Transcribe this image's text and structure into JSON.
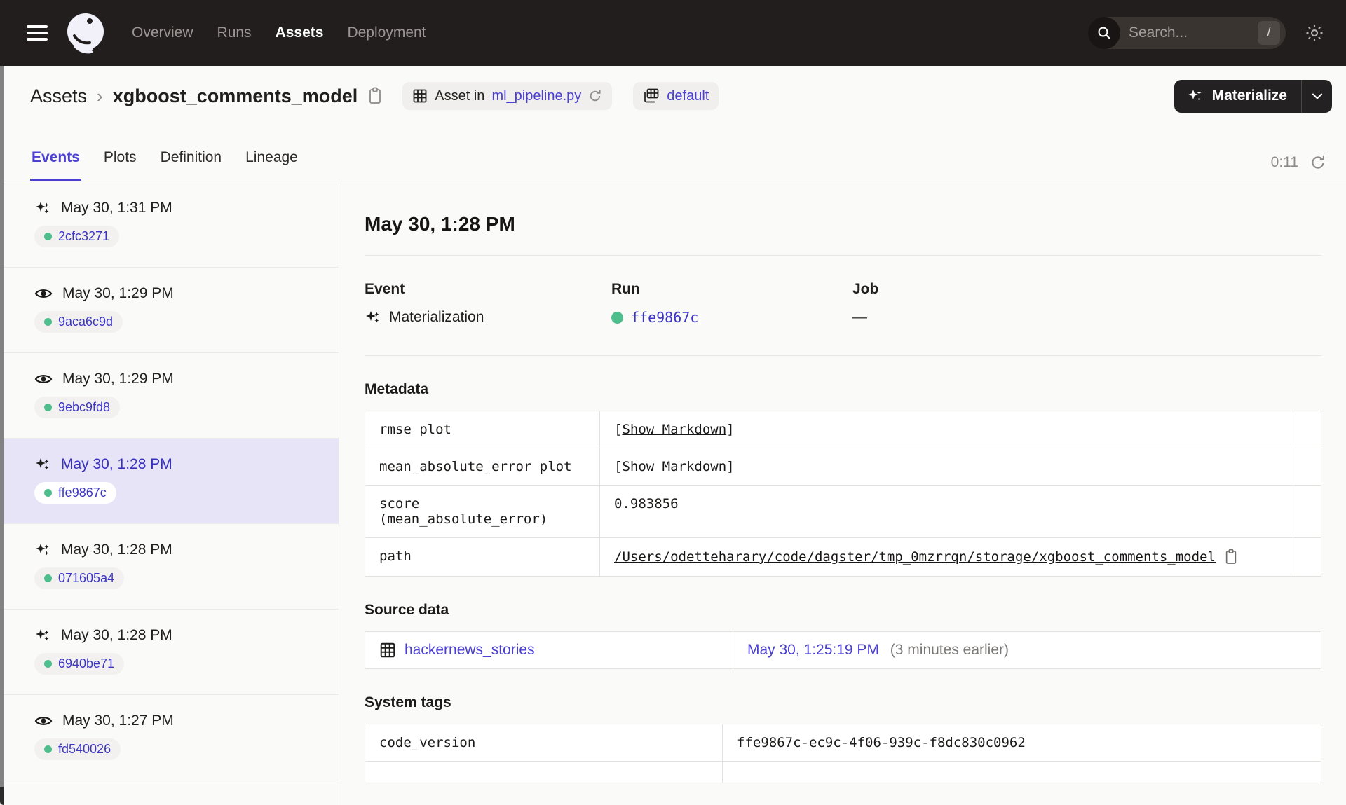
{
  "colors": {
    "navbar_bg": "#221E1D",
    "accent": "#4B40D2",
    "run_green": "#4FBE8D",
    "selected_bg": "#E7E4F7",
    "page_bg": "#FAFAF8"
  },
  "navbar": {
    "logo": "dagster-logo",
    "items": [
      {
        "label": "Overview",
        "active": false
      },
      {
        "label": "Runs",
        "active": false
      },
      {
        "label": "Assets",
        "active": true
      },
      {
        "label": "Deployment",
        "active": false
      }
    ],
    "search": {
      "placeholder": "Search...",
      "shortcut": "/"
    }
  },
  "header": {
    "breadcrumb": {
      "root": "Assets",
      "separator": "›",
      "asset": "xgboost_comments_model"
    },
    "chips": [
      {
        "prefix": "Asset in ",
        "link": "ml_pipeline.py",
        "icon": "table-grid-icon",
        "refresh": true
      },
      {
        "prefix": "",
        "link": "default",
        "icon": "repo-grid-icon",
        "refresh": false
      }
    ],
    "materialize": {
      "label": "Materialize"
    }
  },
  "tabs": {
    "items": [
      {
        "label": "Events",
        "active": true
      },
      {
        "label": "Plots",
        "active": false
      },
      {
        "label": "Definition",
        "active": false
      },
      {
        "label": "Lineage",
        "active": false
      }
    ],
    "timer": "0:11"
  },
  "sidebar": {
    "events": [
      {
        "icon": "materialization",
        "time": "May 30, 1:31 PM",
        "run_id": "2cfc3271",
        "selected": false
      },
      {
        "icon": "observation",
        "time": "May 30, 1:29 PM",
        "run_id": "9aca6c9d",
        "selected": false
      },
      {
        "icon": "observation",
        "time": "May 30, 1:29 PM",
        "run_id": "9ebc9fd8",
        "selected": false
      },
      {
        "icon": "materialization",
        "time": "May 30, 1:28 PM",
        "run_id": "ffe9867c",
        "selected": true
      },
      {
        "icon": "materialization",
        "time": "May 30, 1:28 PM",
        "run_id": "071605a4",
        "selected": false
      },
      {
        "icon": "materialization",
        "time": "May 30, 1:28 PM",
        "run_id": "6940be71",
        "selected": false
      },
      {
        "icon": "observation",
        "time": "May 30, 1:27 PM",
        "run_id": "fd540026",
        "selected": false
      }
    ]
  },
  "detail": {
    "title": "May 30, 1:28 PM",
    "summary": {
      "event_label": "Event",
      "event_value": "Materialization",
      "run_label": "Run",
      "run_value": "ffe9867c",
      "job_label": "Job",
      "job_value": "—"
    },
    "metadata": {
      "heading": "Metadata",
      "show_markdown_label": "Show Markdown",
      "bracket_open": "[",
      "bracket_close": "]",
      "rows": [
        {
          "key": "rmse plot",
          "type": "markdown"
        },
        {
          "key": "mean_absolute_error plot",
          "type": "markdown"
        },
        {
          "key": "score (mean_absolute_error)",
          "type": "text",
          "value": "0.983856"
        },
        {
          "key": "path",
          "type": "path",
          "value": "/Users/odetteharary/code/dagster/tmp_0mzrrqn/storage/xgboost_comments_model"
        }
      ]
    },
    "source_data": {
      "heading": "Source data",
      "asset": "hackernews_stories",
      "timestamp": "May 30, 1:25:19 PM",
      "relative": "(3 minutes earlier)"
    },
    "system_tags": {
      "heading": "System tags",
      "rows": [
        {
          "key": "code_version",
          "value": "ffe9867c-ec9c-4f06-939c-f8dc830c0962"
        }
      ]
    }
  }
}
